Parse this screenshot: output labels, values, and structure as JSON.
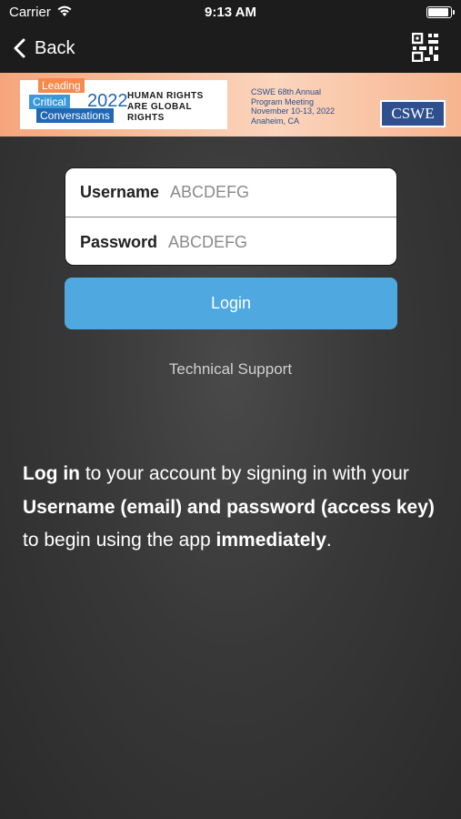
{
  "status_bar": {
    "carrier": "Carrier",
    "time": "9:13 AM"
  },
  "nav": {
    "back_label": "Back"
  },
  "banner": {
    "lcc_leading": "Leading",
    "lcc_critical": "Critical",
    "lcc_conversations": "Conversations",
    "lcc_year": "2022",
    "theme_line1": "HUMAN RIGHTS",
    "theme_line2": "ARE GLOBAL",
    "theme_line3": "RIGHTS",
    "meeting_line1": "CSWE 68th Annual",
    "meeting_line2": "Program Meeting",
    "meeting_line3": "November 10-13, 2022",
    "meeting_line4": "Anaheim, CA",
    "logo": "CSWE"
  },
  "form": {
    "username_label": "Username",
    "username_placeholder": "ABCDEFG",
    "password_label": "Password",
    "password_placeholder": "ABCDEFG"
  },
  "login_label": "Login",
  "support_label": "Technical Support",
  "info": {
    "p1_bold": "Log in",
    "p1_rest": " to your account by signing in with your ",
    "p2_bold": "Username (email) and password (access key)",
    "p2_rest": " to begin using the app ",
    "p3_bold": "immediately",
    "p3_rest": "."
  },
  "colors": {
    "accent": "#4fa8df",
    "nav_bg": "#1c1c1c",
    "banner_orange": "#f6a57a"
  }
}
